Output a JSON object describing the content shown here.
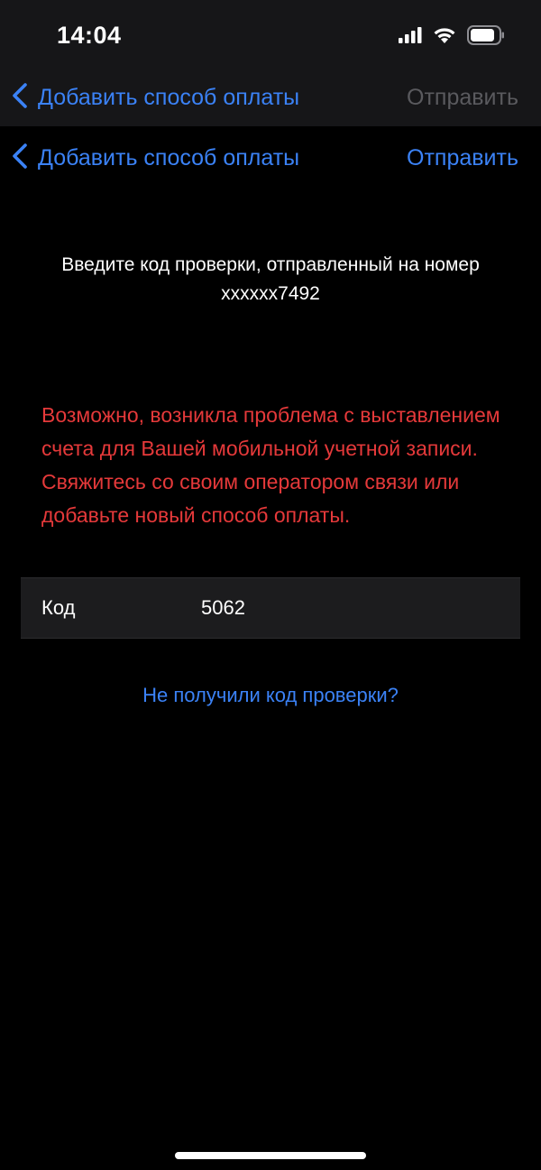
{
  "status_bar": {
    "time": "14:04",
    "icons": [
      "cellular-signal-icon",
      "wifi-icon",
      "battery-icon"
    ]
  },
  "nav_back_layer": {
    "back_label": "Добавить способ оплаты",
    "action_label": "Отправить"
  },
  "nav_front_layer": {
    "back_label": "Добавить способ оплаты",
    "action_label": "Отправить"
  },
  "main": {
    "instruction_line1": "Введите код проверки, отправленный на номер",
    "instruction_line2": "xxxxxx7492",
    "error_message": "Возможно, возникла проблема с выставлением счета для Вашей мобильной учетной записи. Свяжитесь со своим оператором связи или добавьте новый способ оплаты.",
    "code_label": "Код",
    "code_value": "5062",
    "resend_link": "Не получили код проверки?"
  },
  "colors": {
    "accent": "#3b82f6",
    "error": "#e5393a",
    "disabled": "#5a5a5e",
    "background": "#000000",
    "row_background": "#1c1c1e"
  }
}
